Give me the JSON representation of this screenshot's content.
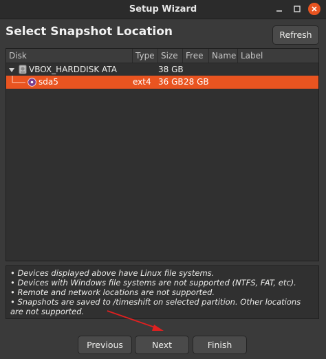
{
  "window": {
    "title": "Setup Wizard"
  },
  "heading": "Select Snapshot Location",
  "toolbar": {
    "refresh_label": "Refresh"
  },
  "table": {
    "columns": [
      "Disk",
      "Type",
      "Size",
      "Free",
      "Name",
      "Label"
    ],
    "rows": [
      {
        "disk": "VBOX_HARDDISK ATA",
        "type": "",
        "size": "38 GB",
        "free": "",
        "name": "",
        "label": "",
        "expanded": true,
        "icon": "hard-disk-icon"
      },
      {
        "disk": "sda5",
        "type": "ext4",
        "size": "36 GB",
        "free": "28 GB",
        "name": "",
        "label": "",
        "selected": true,
        "icon": "partition-icon"
      }
    ]
  },
  "info": {
    "lines": [
      "• Devices displayed above have Linux file systems.",
      "• Devices with Windows file systems are not supported (NTFS, FAT, etc).",
      "• Remote and network locations are not supported.",
      "• Snapshots are saved to /timeshift on selected partition. Other locations are not supported."
    ]
  },
  "buttons": {
    "previous": "Previous",
    "next": "Next",
    "finish": "Finish"
  },
  "colors": {
    "accent": "#e95420",
    "background": "#3a3a3a",
    "panel": "#303030",
    "annotation_arrow": "#e02020"
  }
}
